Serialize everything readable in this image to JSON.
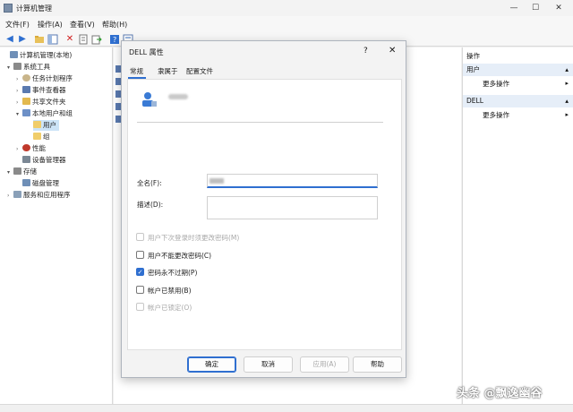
{
  "window": {
    "title": "计算机管理",
    "min": "—",
    "max": "☐",
    "close": "✕"
  },
  "menu": [
    {
      "label": "文件(F)"
    },
    {
      "label": "操作(A)"
    },
    {
      "label": "查看(V)"
    },
    {
      "label": "帮助(H)"
    }
  ],
  "tree": [
    {
      "label": "计算机管理(本地)",
      "icon": "computer-icon",
      "arrow": ""
    },
    {
      "label": "系统工具",
      "icon": "tools-icon",
      "arrow": "▾"
    },
    {
      "label": "任务计划程序",
      "icon": "clock-icon",
      "arrow": "›"
    },
    {
      "label": "事件查看器",
      "icon": "event-icon",
      "arrow": "›"
    },
    {
      "label": "共享文件夹",
      "icon": "share-folder-icon",
      "arrow": "›"
    },
    {
      "label": "本地用户和组",
      "icon": "users-icon",
      "arrow": "▾"
    },
    {
      "label": "用户",
      "icon": "folder-icon",
      "arrow": ""
    },
    {
      "label": "组",
      "icon": "folder-icon",
      "arrow": ""
    },
    {
      "label": "性能",
      "icon": "performance-icon",
      "arrow": "›"
    },
    {
      "label": "设备管理器",
      "icon": "device-icon",
      "arrow": ""
    },
    {
      "label": "存储",
      "icon": "storage-icon",
      "arrow": "▾"
    },
    {
      "label": "磁盘管理",
      "icon": "disk-icon",
      "arrow": ""
    },
    {
      "label": "服务和应用程序",
      "icon": "services-icon",
      "arrow": "›"
    }
  ],
  "actions": {
    "header": "操作",
    "section1": "用户",
    "more1": "更多操作",
    "section2": "DELL",
    "more2": "更多操作",
    "chevron_section": "▴",
    "chevron_item": "▸"
  },
  "dialog": {
    "title": "DELL 属性",
    "help": "?",
    "close": "✕",
    "tabs": [
      "常规",
      "隶属于",
      "配置文件"
    ],
    "fullname_label": "全名(F):",
    "desc_label": "描述(D):",
    "checkboxes": [
      {
        "label": "用户下次登录时须更改密码(M)",
        "checked": false,
        "disabled": true
      },
      {
        "label": "用户不能更改密码(C)",
        "checked": false,
        "disabled": false
      },
      {
        "label": "密码永不过期(P)",
        "checked": true,
        "disabled": false
      },
      {
        "label": "帐户已禁用(B)",
        "checked": false,
        "disabled": false
      },
      {
        "label": "帐户已锁定(O)",
        "checked": false,
        "disabled": true
      }
    ],
    "buttons": {
      "ok": "确定",
      "cancel": "取消",
      "apply": "应用(A)",
      "help": "帮助"
    }
  },
  "watermark": "头条 @飘逸幽谷",
  "colors": {
    "accent": "#2f6fd0",
    "selection": "#cce4f7"
  }
}
